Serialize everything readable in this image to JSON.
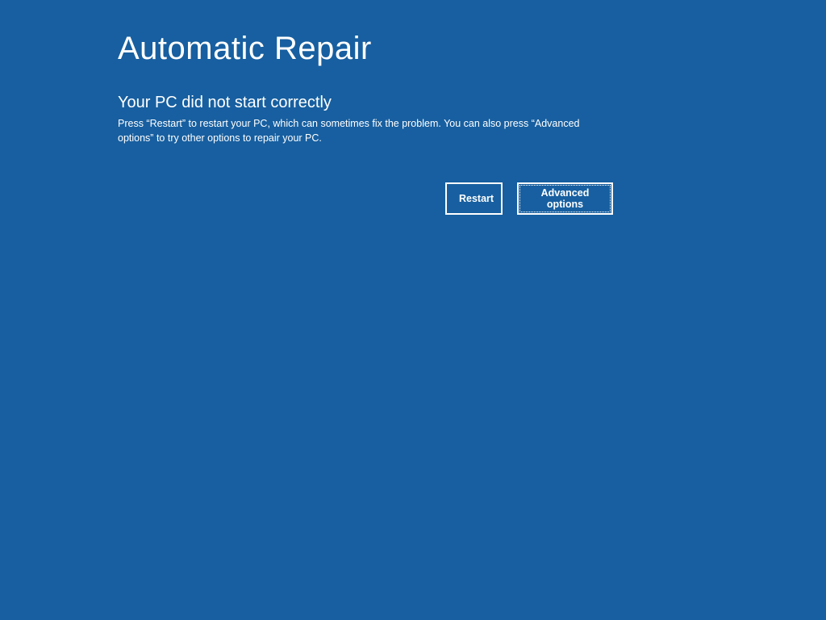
{
  "title": "Automatic Repair",
  "subtitle": "Your PC did not start correctly",
  "description": "Press “Restart” to restart your PC, which can sometimes fix the problem. You can also press “Advanced options” to try other options to repair your PC.",
  "buttons": {
    "restart": "Restart",
    "advanced": "Advanced options"
  }
}
